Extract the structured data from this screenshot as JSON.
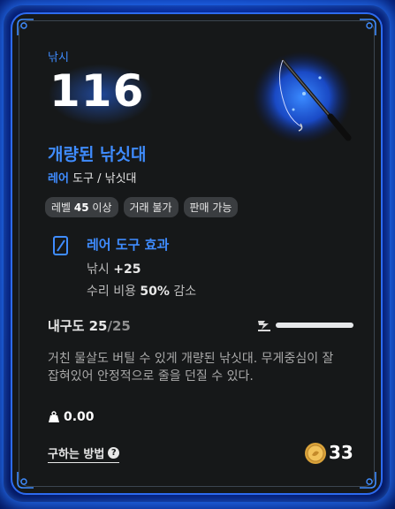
{
  "item": {
    "category": "낚시",
    "power": "116",
    "name": "개량된 낚싯대",
    "rarity": "레어",
    "type": "도구 / 낚싯대"
  },
  "tags": [
    {
      "prefix": "레벨 ",
      "strong": "45",
      "suffix": " 이상"
    },
    {
      "prefix": "거래 불가",
      "strong": "",
      "suffix": ""
    },
    {
      "prefix": "판매 가능",
      "strong": "",
      "suffix": ""
    }
  ],
  "effect": {
    "title": "레어 도구 효과",
    "line1_label": "낚시 ",
    "line1_value": "+25",
    "line2_label": "수리 비용 ",
    "line2_value": "50%",
    "line2_suffix": " 감소"
  },
  "durability": {
    "label": "내구도 ",
    "current": "25",
    "max": "/25",
    "fraction": 1.0
  },
  "description": "거친 물살도 버틸 수 있게 개량된 낚싯대. 무게중심이 잘 잡혀있어 안정적으로 줄을 던질 수 있다.",
  "weight": "0.00",
  "footer": {
    "how_to_obtain": "구하는 방법",
    "price": "33"
  },
  "colors": {
    "accent": "#3f8cff",
    "card_bg": "#161819",
    "frame": "#2d6bf0"
  },
  "icons": [
    "fishing-rod-icon",
    "effect-icon",
    "durability-icon",
    "weight-icon",
    "help-icon",
    "coin-icon"
  ]
}
